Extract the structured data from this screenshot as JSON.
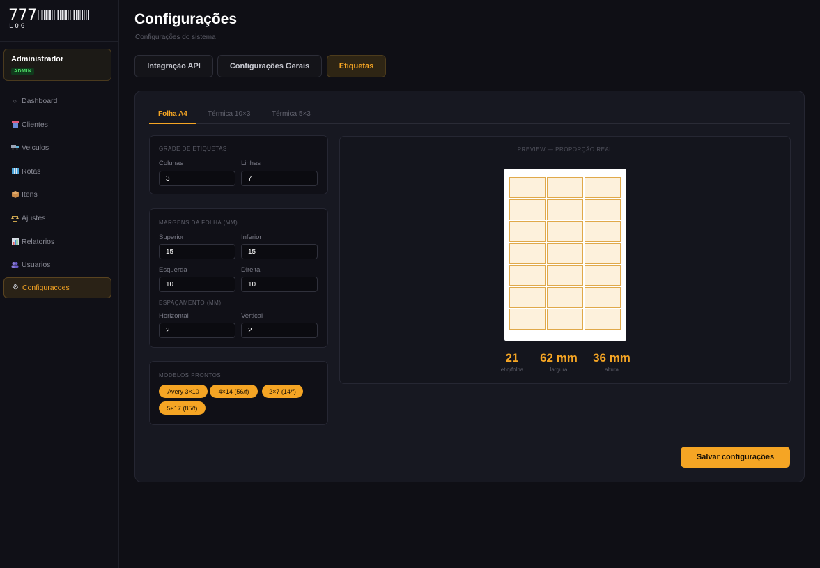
{
  "logo": {
    "number": "777",
    "sub": "LOG"
  },
  "user": {
    "name": "Administrador",
    "role": "ADMIN"
  },
  "nav": [
    {
      "label": "Dashboard",
      "icon": "circle-icon"
    },
    {
      "label": "Clientes",
      "icon": "store-icon"
    },
    {
      "label": "Veiculos",
      "icon": "truck-icon"
    },
    {
      "label": "Rotas",
      "icon": "map-icon"
    },
    {
      "label": "Itens",
      "icon": "package-icon"
    },
    {
      "label": "Ajustes",
      "icon": "scale-icon"
    },
    {
      "label": "Relatorios",
      "icon": "chart-icon"
    },
    {
      "label": "Usuarios",
      "icon": "users-icon"
    },
    {
      "label": "Configuracoes",
      "icon": "gear-icon",
      "active": true
    }
  ],
  "page": {
    "title": "Configurações",
    "subtitle": "Configurações do sistema"
  },
  "tabs": [
    {
      "label": "Integração API"
    },
    {
      "label": "Configurações Gerais"
    },
    {
      "label": "Etiquetas",
      "active": true
    }
  ],
  "subtabs": [
    {
      "label": "Folha A4",
      "active": true
    },
    {
      "label": "Térmica 10×3"
    },
    {
      "label": "Térmica 5×3"
    }
  ],
  "grid": {
    "title": "GRADE DE ETIQUETAS",
    "columns_label": "Colunas",
    "columns_value": "3",
    "rows_label": "Linhas",
    "rows_value": "7"
  },
  "margins": {
    "title": "MARGENS DA FOLHA (MM)",
    "top_label": "Superior",
    "top_value": "15",
    "bottom_label": "Inferior",
    "bottom_value": "15",
    "left_label": "Esquerda",
    "left_value": "10",
    "right_label": "Direita",
    "right_value": "10",
    "spacing_title": "ESPAÇAMENTO (MM)",
    "horizontal_label": "Horizontal",
    "horizontal_value": "2",
    "vertical_label": "Vertical",
    "vertical_value": "2"
  },
  "presets": {
    "title": "MODELOS PRONTOS",
    "items": [
      "Avery 3×10",
      "4×14 (56/f)",
      "2×7 (14/f)",
      "5×17 (85/f)"
    ]
  },
  "preview": {
    "title": "PREVIEW — PROPORÇÃO REAL",
    "stats": [
      {
        "value": "21",
        "label": "etiq/folha"
      },
      {
        "value": "62 mm",
        "label": "largura"
      },
      {
        "value": "36 mm",
        "label": "altura"
      }
    ]
  },
  "save_label": "Salvar configurações",
  "colors": {
    "accent": "#f5a524",
    "background": "#0f0f15",
    "panel": "#171821"
  }
}
